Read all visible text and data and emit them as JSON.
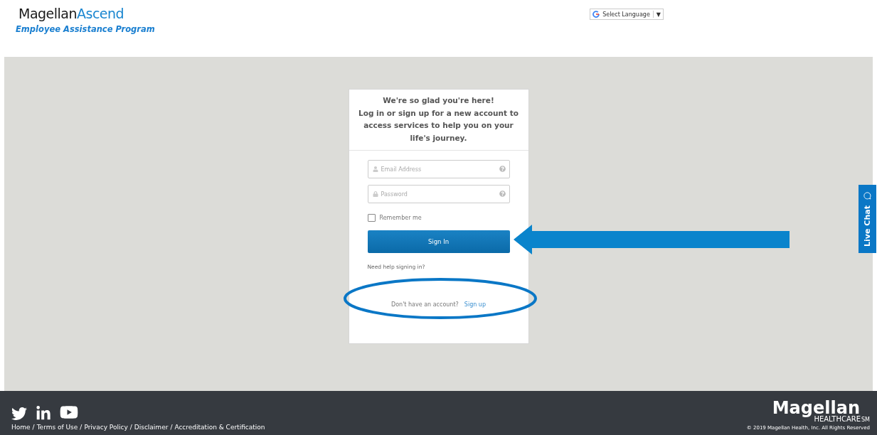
{
  "header": {
    "brand": "Magellan",
    "brand_accent": "Ascend",
    "subtitle": "Employee Assistance Program",
    "language": {
      "label": "Select Language",
      "caret": "▼"
    }
  },
  "login": {
    "heading": [
      "We're so glad you're here!",
      "Log in or sign up for a new account to access services to help you on your life's journey."
    ],
    "email": {
      "placeholder": "Email Address"
    },
    "password": {
      "placeholder": "Password"
    },
    "remember": {
      "label": "Remember me",
      "checked": false
    },
    "sign_in": "Sign In",
    "help": "Need help signing in?",
    "signup_prompt": "Don't have an account?",
    "signup_link": "Sign up"
  },
  "live_chat": "Live Chat",
  "footer": {
    "links": [
      "Home",
      "Terms of Use",
      "Privacy Policy",
      "Disclaimer",
      "Accreditation & Certification"
    ],
    "separator": "/",
    "logo": "Magellan",
    "logo_sub": "HEALTHCARE",
    "logo_mark": "SM",
    "copyright": "© 2019 Magellan Health, Inc. All Rights Reserved"
  }
}
